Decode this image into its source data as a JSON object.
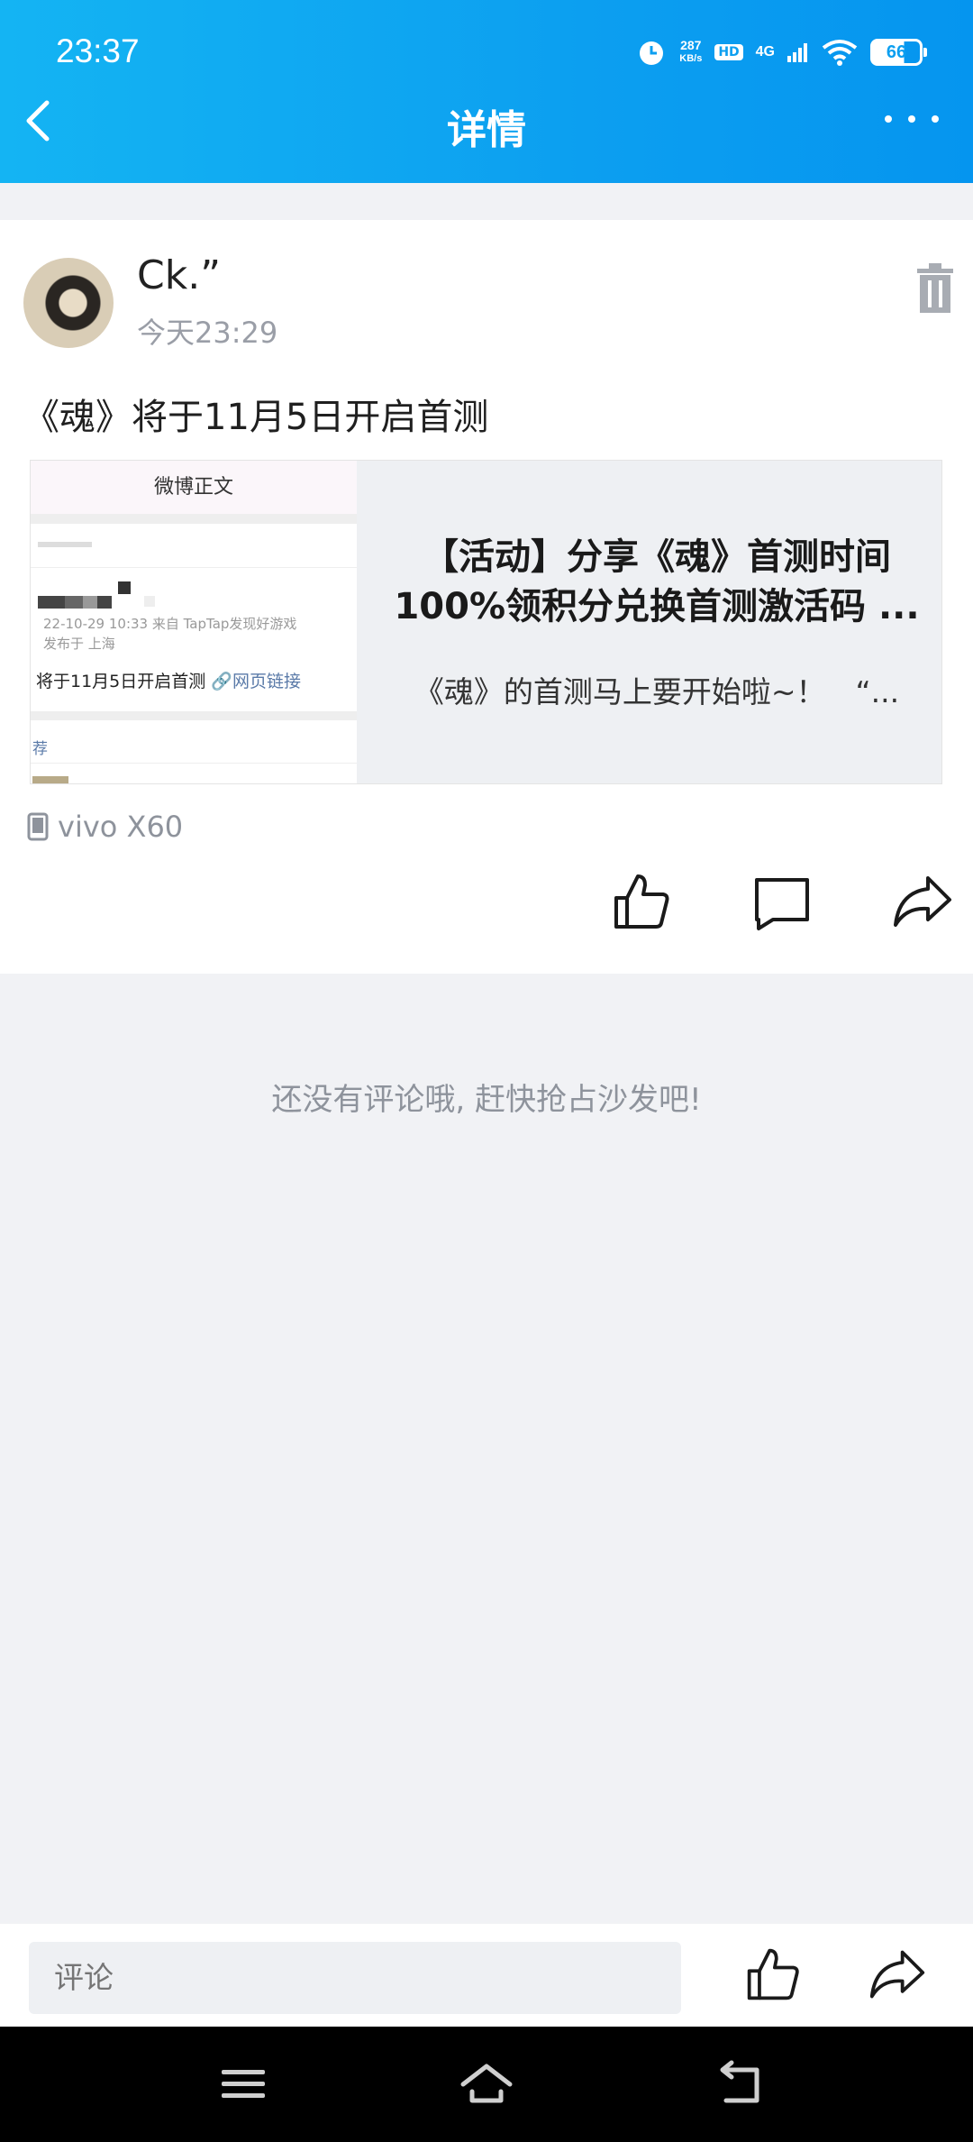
{
  "status": {
    "time": "23:37",
    "net_speed_value": "287",
    "net_speed_unit": "KB/s",
    "hd": "HD",
    "network": "4G",
    "battery": "66"
  },
  "header": {
    "title": "详情"
  },
  "post": {
    "username": "Ck.”",
    "time": "今天23:29",
    "text": "《魂》将于11月5日开启首测",
    "share": {
      "thumb_header": "微博正文",
      "thumb_meta1": "22-10-29 10:33  来自 TapTap发现好游戏",
      "thumb_meta2": "发布于 上海",
      "thumb_body": "将于11月5日开启首测",
      "thumb_link": "🔗网页链接",
      "thumb_rec": "荐",
      "title_line1": "【活动】分享《魂》首测时间",
      "title_line2": "100%领积分兑换首测激活码 ...",
      "desc": "《魂》的首测马上要开始啦~！　“..."
    },
    "device": "vivo X60"
  },
  "comments": {
    "empty_message": "还没有评论哦, 赶快抢占沙发吧!"
  },
  "comment_bar": {
    "placeholder": "评论"
  }
}
